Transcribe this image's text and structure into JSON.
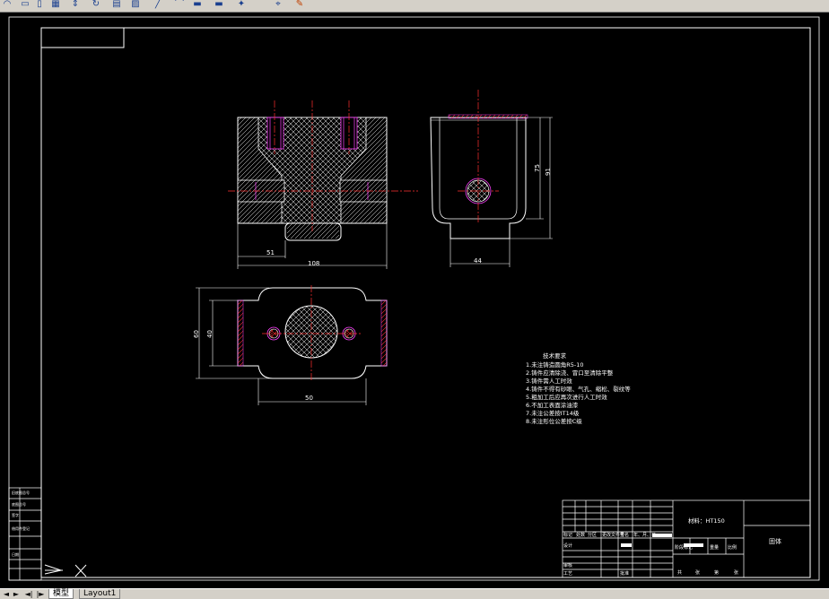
{
  "toolbar": {
    "icons": [
      "arc-icon",
      "rectangle-icon",
      "grid-icon",
      "flip-icon",
      "rotate-icon",
      "table-icon",
      "hatch-icon",
      "line-icon",
      "curve-icon",
      "block-icon",
      "block-icon",
      "star-icon",
      "layer-icon",
      "pointer-icon",
      "paint-icon"
    ]
  },
  "drawing": {
    "dims": {
      "front_total": "108",
      "front_partial": "51",
      "side_width": "44",
      "side_h1": "75",
      "side_h2": "91",
      "top_h1": "60",
      "top_h2": "40",
      "top_width": "50"
    },
    "notes": {
      "title": "技术要求",
      "items": [
        "1.未注铸造圆角R5-10",
        "2.铸件应清除浇、冒口至清除平整",
        "3.铸件需人工时效",
        "4.铸件不得有砂眼、气孔、缩松、裂纹等",
        "5.粗加工后应再次进行人工时效",
        "6.不加工表面涂油漆",
        "7.未注公差按IT14级",
        "8.未注形位公差按C级"
      ]
    },
    "title_block": {
      "material": "材料：HT150",
      "part_name": "固体",
      "labels": [
        "标记",
        "处数",
        "分区",
        "更改文件号",
        "签名",
        "年、月、日",
        "设计",
        "审核",
        "工艺",
        "批准",
        "阶段标记",
        "重量",
        "比例",
        "共",
        "张",
        "第",
        "张"
      ]
    },
    "left_strip_labels": [
      "借用件登记",
      "旧底图总号",
      "底图总号",
      "签字",
      "日期"
    ]
  },
  "status": {
    "nav": [
      "◄",
      "►",
      "◄|",
      "|►"
    ],
    "tabs": [
      {
        "label": "模型",
        "active": true
      },
      {
        "label": "Layout1",
        "active": false
      }
    ]
  },
  "colors": {
    "background": "#000000",
    "lines": "#ffffff",
    "center_lines": "#ff2020",
    "hidden_lines": "#ff00ff"
  }
}
